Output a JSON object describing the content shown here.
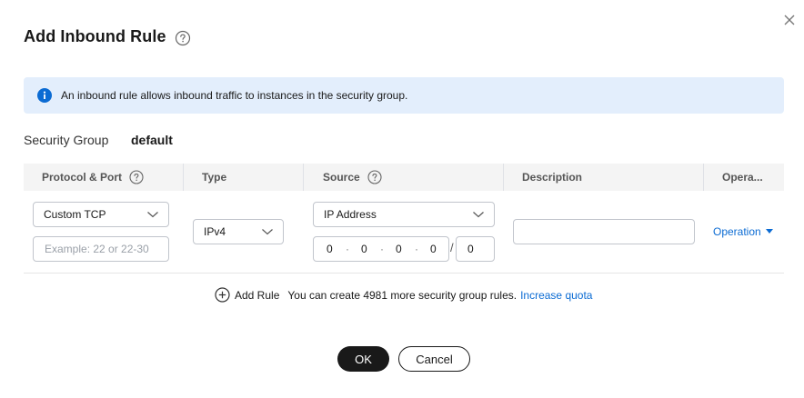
{
  "dialog": {
    "title": "Add Inbound Rule",
    "close_icon": "close-icon",
    "help_icon": "help-circle-icon"
  },
  "banner": {
    "icon": "info-icon",
    "text": "An inbound rule allows inbound traffic to instances in the security group."
  },
  "security_group": {
    "label": "Security Group",
    "value": "default"
  },
  "table": {
    "headers": {
      "protocol_port": "Protocol & Port",
      "type": "Type",
      "source": "Source",
      "description": "Description",
      "operation": "Opera..."
    },
    "row": {
      "protocol": "Custom TCP",
      "port_placeholder": "Example: 22 or 22-30",
      "type": "IPv4",
      "source_type": "IP Address",
      "ip": [
        "0",
        "0",
        "0",
        "0"
      ],
      "mask": "0",
      "description": "",
      "operation": "Operation"
    }
  },
  "footer": {
    "add_rule": "Add Rule",
    "quota_text": "You can create 4981 more security group rules.",
    "quota_link": "Increase quota"
  },
  "buttons": {
    "ok": "OK",
    "cancel": "Cancel"
  },
  "colors": {
    "link": "#0b6bd3",
    "primary_button": "#191919",
    "banner_bg": "#e3eefc",
    "info_icon": "#0b6bd3"
  }
}
